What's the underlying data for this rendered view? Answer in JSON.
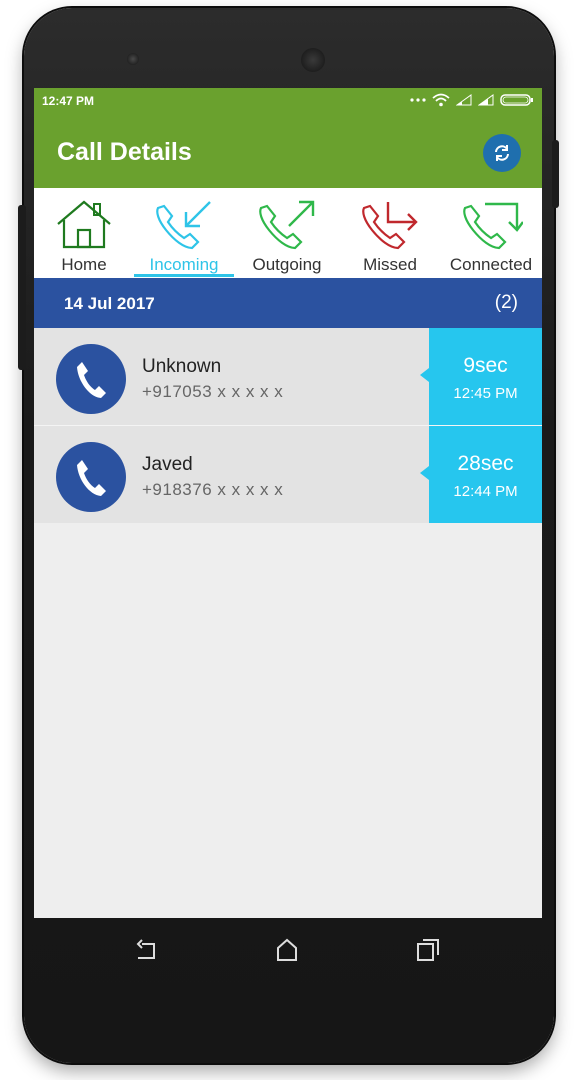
{
  "status_bar": {
    "time": "12:47 PM"
  },
  "app_bar": {
    "title": "Call Details"
  },
  "tabs": [
    {
      "label": "Home",
      "icon": "home-icon"
    },
    {
      "label": "Incoming",
      "icon": "incoming-call-icon"
    },
    {
      "label": "Outgoing",
      "icon": "outgoing-call-icon"
    },
    {
      "label": "Missed",
      "icon": "missed-call-icon"
    },
    {
      "label": "Connected",
      "icon": "connected-call-icon"
    }
  ],
  "active_tab": "Incoming",
  "date_header": {
    "date": "14 Jul 2017",
    "count": "(2)"
  },
  "calls": [
    {
      "name": "Unknown",
      "number": "+917053 x x x x x",
      "duration": "9sec",
      "time": "12:45 PM"
    },
    {
      "name": "Javed",
      "number": "+918376 x x x x x",
      "duration": "28sec",
      "time": "12:44 PM"
    }
  ],
  "colors": {
    "app_bar": "#6aa12e",
    "date_bar": "#2b52a0",
    "duration_box": "#26c6ee",
    "active_tab": "#2ec4e8",
    "home_icon": "#1f7a1f",
    "incoming_icon": "#2ec4e8",
    "outgoing_icon": "#2fb84a",
    "missed_icon": "#c0282d",
    "connected_icon": "#2fb84a"
  }
}
